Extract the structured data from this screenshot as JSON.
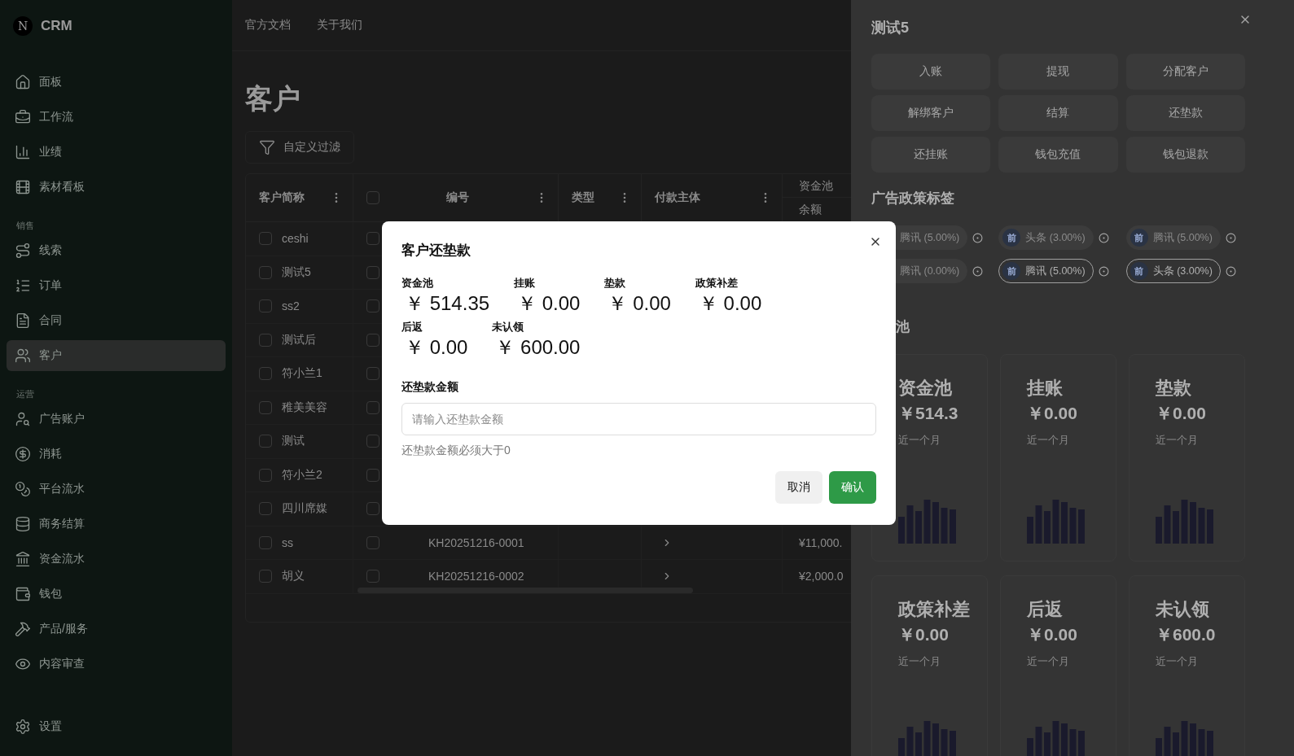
{
  "brand": {
    "logo": "N",
    "name": "CRM"
  },
  "sidebar": {
    "groups": [
      {
        "items": [
          {
            "label": "面板",
            "selected": false
          },
          {
            "label": "工作流",
            "selected": false
          },
          {
            "label": "业绩",
            "selected": false
          },
          {
            "label": "素材看板",
            "selected": false
          }
        ]
      },
      {
        "label": "销售",
        "items": [
          {
            "label": "线索",
            "selected": false
          },
          {
            "label": "订单",
            "selected": false
          },
          {
            "label": "合同",
            "selected": false
          },
          {
            "label": "客户",
            "selected": true
          }
        ]
      },
      {
        "label": "运营",
        "items": [
          {
            "label": "广告账户",
            "selected": false
          },
          {
            "label": "消耗",
            "selected": false
          },
          {
            "label": "平台流水",
            "selected": false
          },
          {
            "label": "商务结算",
            "selected": false
          },
          {
            "label": "资金流水",
            "selected": false
          },
          {
            "label": "钱包",
            "selected": false
          },
          {
            "label": "产品/服务",
            "selected": false
          },
          {
            "label": "内容审查",
            "selected": false
          }
        ]
      }
    ],
    "footer": {
      "label": "设置",
      "selected": false
    }
  },
  "top_nav": [
    "官方文档",
    "关于我们"
  ],
  "page_title": "客户",
  "filter_button": "自定义过滤",
  "table": {
    "columns": [
      {
        "label": "客户简称"
      },
      {
        "label": "编号"
      },
      {
        "label": "类型"
      },
      {
        "label": "付款主体"
      }
    ],
    "group_column": {
      "label": "资金池",
      "sub": "余额"
    },
    "select_all": false,
    "rows": [
      {
        "name": "ceshi",
        "checked": false
      },
      {
        "name": "测试5",
        "checked": false
      },
      {
        "name": "ss2",
        "checked": false
      },
      {
        "name": "测试后",
        "checked": false
      },
      {
        "name": "符小兰1",
        "checked": false
      },
      {
        "name": "稚美美容",
        "checked": false
      },
      {
        "name": "测试",
        "checked": false
      },
      {
        "name": "符小兰2",
        "checked": false
      },
      {
        "name": "四川席媒",
        "checked": false
      },
      {
        "name": "ss",
        "checked": false,
        "code": "KH20251216-0001",
        "expandable": true,
        "amount": "¥11,000."
      },
      {
        "name": "胡义",
        "checked": false,
        "code": "KH20251216-0002",
        "expandable": true,
        "amount": "¥2,000.0"
      }
    ]
  },
  "sheet": {
    "title": "测试5",
    "actions": [
      "入账",
      "提现",
      "分配客户",
      "解绑客户",
      "结算",
      "还垫款",
      "还挂账",
      "钱包充值",
      "钱包退款"
    ],
    "tags_heading": "广告政策标签",
    "tags": [
      {
        "label": "腾讯 (5.00%)",
        "active": false
      },
      {
        "badge": "前",
        "label": "头条 (3.00%)",
        "active": false
      },
      {
        "badge": "前",
        "label": "腾讯 (5.00%)",
        "active": false
      },
      {
        "label": "腾讯 (0.00%)",
        "active": false
      },
      {
        "badge": "前",
        "label": "腾讯 (5.00%)",
        "active": true
      },
      {
        "badge": "前",
        "label": "头条 (3.00%)",
        "active": true
      }
    ],
    "pool_heading": "池",
    "cards": [
      {
        "title": "资金池",
        "amount": "￥514.3",
        "caption": "近一个月"
      },
      {
        "title": "挂账",
        "amount": "￥0.00",
        "caption": "近一个月"
      },
      {
        "title": "垫款",
        "amount": "￥0.00",
        "caption": "近一个月"
      },
      {
        "title": "政策补差",
        "amount": "￥0.00",
        "caption": "近一个月"
      },
      {
        "title": "后返",
        "amount": "￥0.00",
        "caption": "近一个月"
      },
      {
        "title": "未认领",
        "amount": "￥600.0",
        "caption": "近一个月"
      }
    ]
  },
  "modal": {
    "title": "客户还垫款",
    "stats": [
      {
        "label": "资金池",
        "value": "￥ 514.35"
      },
      {
        "label": "挂账",
        "value": "￥ 0.00"
      },
      {
        "label": "垫款",
        "value": "￥ 0.00"
      },
      {
        "label": "政策补差",
        "value": "￥ 0.00"
      },
      {
        "label": "后返",
        "value": "￥ 0.00"
      },
      {
        "label": "未认领",
        "value": "￥ 600.00"
      }
    ],
    "field": {
      "label": "还垫款金额",
      "placeholder": "请输入还垫款金额"
    },
    "hint": "还垫款金额必须大于0",
    "buttons": [
      {
        "label": "取消",
        "kind": "secondary"
      },
      {
        "label": "确认",
        "kind": "primary"
      }
    ]
  }
}
